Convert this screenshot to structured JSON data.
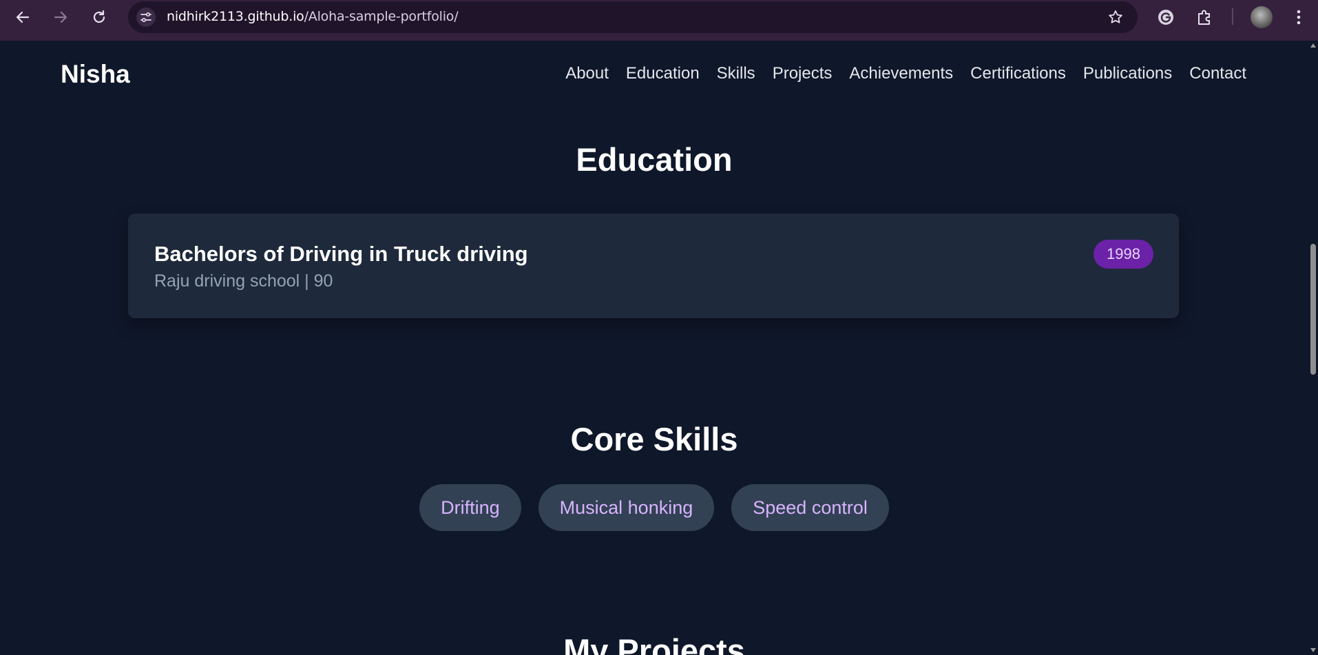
{
  "browser": {
    "url_host": "nidhirk2113.github.io",
    "url_path": "/Aloha-sample-portfolio/",
    "icons": [
      "back-icon",
      "forward-icon",
      "reload-icon",
      "site-info-icon",
      "bookmark-star-icon",
      "grammarly-icon",
      "extensions-icon",
      "profile-avatar",
      "more-menu-icon"
    ]
  },
  "site": {
    "brand": "Nisha",
    "nav": [
      "About",
      "Education",
      "Skills",
      "Projects",
      "Achievements",
      "Certifications",
      "Publications",
      "Contact"
    ]
  },
  "education": {
    "title": "Education",
    "entries": [
      {
        "degree": "Bachelors of Driving in Truck driving",
        "meta": "Raju driving school | 90",
        "year": "1998"
      }
    ]
  },
  "skills": {
    "title": "Core Skills",
    "items": [
      "Drifting",
      "Musical honking",
      "Speed control"
    ]
  },
  "projects": {
    "title": "My Projects"
  },
  "colors": {
    "page_bg": "#0f172a",
    "card_bg": "#1e293b",
    "pill_bg": "#334155",
    "pill_text": "#d8b4fe",
    "badge_bg": "#6b21a8",
    "chrome_bg": "#35213e"
  }
}
